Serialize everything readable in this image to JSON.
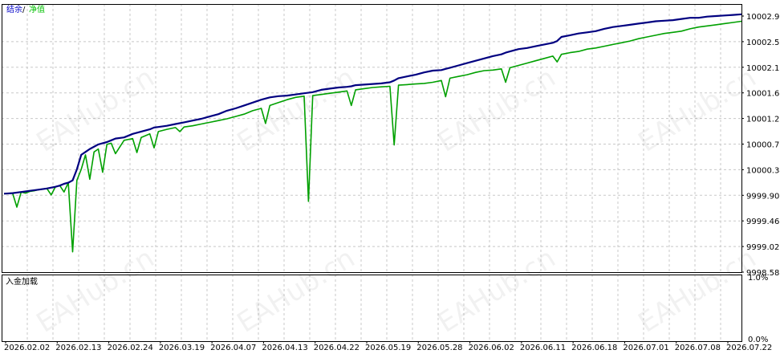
{
  "chart_data": [
    {
      "type": "line",
      "legend": [
        {
          "label": "结余",
          "color": "#0000c8"
        },
        {
          "label": "净值",
          "color": "#00c000"
        }
      ],
      "legend_separator": "/",
      "y_ticks": [
        "10002.99",
        "10002.55",
        "10002.11",
        "10001.67",
        "10001.22",
        "10000.78",
        "10000.34",
        "9999.90",
        "9999.46",
        "9999.02",
        "9998.58"
      ],
      "ylim": [
        9998.58,
        10002.99
      ],
      "x_ticks": [
        "2026.02.02",
        "2026.02.13",
        "2026.02.24",
        "2026.03.19",
        "2026.04.07",
        "2026.04.13",
        "2026.04.22",
        "2026.05.19",
        "2026.05.28",
        "2026.06.02",
        "2026.06.11",
        "2026.06.18",
        "2026.07.01",
        "2026.07.08",
        "2026.07.22"
      ],
      "grid": true,
      "series": [
        {
          "name": "结余",
          "color": "#000080",
          "x": [
            0,
            2,
            4,
            5,
            6,
            8,
            10,
            12,
            13,
            14,
            15,
            16,
            17,
            18,
            19,
            20,
            22,
            23,
            24,
            25,
            26,
            28,
            30,
            32,
            34,
            35,
            36,
            38,
            40,
            42,
            44,
            46,
            48,
            50,
            52,
            54,
            56,
            58,
            60,
            62,
            64,
            66,
            68,
            70,
            72,
            74,
            76,
            78,
            80,
            81,
            82,
            84,
            86,
            88,
            90,
            91,
            92,
            94,
            96,
            98,
            100,
            102,
            103,
            104,
            106,
            108,
            110,
            112,
            114,
            116,
            117,
            118,
            120,
            122,
            124,
            126,
            128,
            129,
            130,
            132,
            134,
            136,
            138,
            140,
            142,
            144,
            146,
            148,
            150,
            152,
            154,
            156,
            158,
            160,
            162,
            164,
            166,
            168,
            170,
            172
          ],
          "y": [
            9999.93,
            9999.94,
            9999.96,
            9999.97,
            9999.98,
            10000.0,
            10000.02,
            10000.05,
            10000.07,
            10000.1,
            10000.12,
            10000.16,
            10000.35,
            10000.6,
            10000.65,
            10000.7,
            10000.78,
            10000.8,
            10000.82,
            10000.85,
            10000.88,
            10000.9,
            10000.96,
            10001.0,
            10001.04,
            10001.07,
            10001.08,
            10001.1,
            10001.13,
            10001.16,
            10001.19,
            10001.22,
            10001.26,
            10001.3,
            10001.36,
            10001.4,
            10001.45,
            10001.5,
            10001.55,
            10001.59,
            10001.61,
            10001.62,
            10001.64,
            10001.66,
            10001.68,
            10001.72,
            10001.74,
            10001.76,
            10001.77,
            10001.78,
            10001.8,
            10001.81,
            10001.82,
            10001.83,
            10001.85,
            10001.88,
            10001.92,
            10001.95,
            10001.98,
            10002.02,
            10002.05,
            10002.06,
            10002.08,
            10002.1,
            10002.14,
            10002.18,
            10002.22,
            10002.26,
            10002.3,
            10002.33,
            10002.36,
            10002.38,
            10002.42,
            10002.44,
            10002.47,
            10002.5,
            10002.53,
            10002.56,
            10002.63,
            10002.66,
            10002.69,
            10002.71,
            10002.73,
            10002.77,
            10002.8,
            10002.82,
            10002.84,
            10002.86,
            10002.88,
            10002.9,
            10002.91,
            10002.92,
            10002.94,
            10002.96,
            10002.96,
            10002.98,
            10002.99,
            10003.0,
            10003.01,
            10003.02
          ]
        },
        {
          "name": "净值",
          "color": "#00a000",
          "x": [
            0,
            2,
            3,
            4,
            5,
            6,
            7,
            8,
            10,
            11,
            12,
            13,
            14,
            15,
            16,
            17,
            18,
            19,
            20,
            21,
            22,
            23,
            24,
            25,
            26,
            28,
            30,
            31,
            32,
            34,
            35,
            36,
            38,
            40,
            41,
            42,
            44,
            46,
            48,
            50,
            52,
            54,
            56,
            58,
            60,
            61,
            62,
            64,
            66,
            68,
            70,
            71,
            72,
            74,
            76,
            78,
            80,
            81,
            82,
            84,
            86,
            88,
            90,
            91,
            92,
            94,
            96,
            98,
            100,
            102,
            103,
            104,
            106,
            108,
            110,
            112,
            114,
            116,
            117,
            118,
            120,
            122,
            124,
            126,
            128,
            129,
            130,
            132,
            134,
            136,
            138,
            140,
            142,
            144,
            146,
            148,
            150,
            152,
            154,
            156,
            158,
            160,
            162,
            164,
            166,
            168,
            170,
            172
          ],
          "y": [
            9999.93,
            9999.94,
            9999.7,
            9999.96,
            9999.94,
            9999.97,
            9999.98,
            10000.0,
            10000.02,
            9999.91,
            10000.05,
            10000.07,
            9999.96,
            10000.12,
            9998.93,
            10000.16,
            10000.35,
            10000.6,
            10000.18,
            10000.65,
            10000.7,
            10000.3,
            10000.78,
            10000.8,
            10000.62,
            10000.85,
            10000.88,
            10000.64,
            10000.9,
            10000.96,
            10000.72,
            10001.0,
            10001.04,
            10001.07,
            10001.0,
            10001.08,
            10001.1,
            10001.13,
            10001.16,
            10001.19,
            10001.22,
            10001.26,
            10001.3,
            10001.36,
            10001.4,
            10001.14,
            10001.45,
            10001.5,
            10001.55,
            10001.59,
            10001.61,
            9999.8,
            10001.62,
            10001.64,
            10001.66,
            10001.68,
            10001.7,
            10001.45,
            10001.72,
            10001.74,
            10001.76,
            10001.77,
            10001.78,
            10000.77,
            10001.8,
            10001.81,
            10001.82,
            10001.83,
            10001.85,
            10001.88,
            10001.6,
            10001.92,
            10001.95,
            10001.98,
            10002.02,
            10002.05,
            10002.06,
            10002.08,
            10001.85,
            10002.1,
            10002.14,
            10002.18,
            10002.22,
            10002.26,
            10002.3,
            10002.2,
            10002.33,
            10002.36,
            10002.38,
            10002.42,
            10002.44,
            10002.47,
            10002.5,
            10002.53,
            10002.56,
            10002.6,
            10002.63,
            10002.66,
            10002.69,
            10002.71,
            10002.73,
            10002.77,
            10002.8,
            10002.82,
            10002.84,
            10002.86,
            10002.88,
            10002.9
          ]
        }
      ]
    },
    {
      "type": "bar",
      "title": "入金加载",
      "y_ticks": [
        "1.0%",
        "0.0%"
      ],
      "ylim": [
        0,
        1.0
      ],
      "values": []
    }
  ]
}
